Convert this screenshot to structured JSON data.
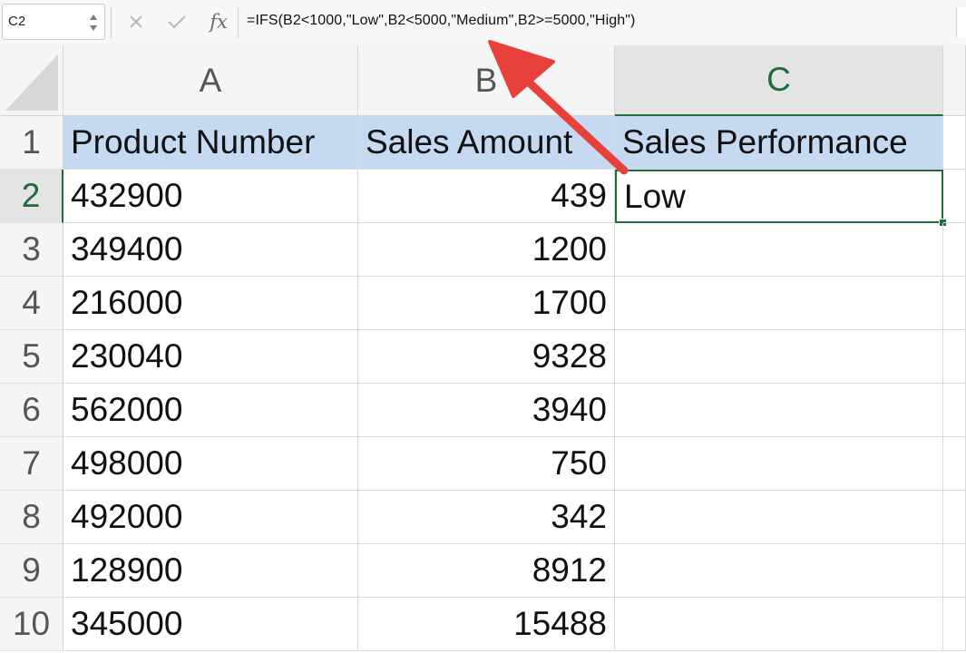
{
  "name_box": {
    "value": "C2"
  },
  "formula_bar": {
    "cancel_icon": "close-icon",
    "enter_icon": "checkmark-icon",
    "fx_label": "fx",
    "formula": "=IFS(B2<1000,\"Low\",B2<5000,\"Medium\",B2>=5000,\"High\")"
  },
  "columns": [
    "A",
    "B",
    "C"
  ],
  "rows": [
    "1",
    "2",
    "3",
    "4",
    "5",
    "6",
    "7",
    "8",
    "9",
    "10"
  ],
  "table": {
    "headers": [
      "Product Number",
      "Sales Amount",
      "Sales Performance"
    ],
    "data": [
      [
        "432900",
        "439",
        "Low"
      ],
      [
        "349400",
        "1200",
        ""
      ],
      [
        "216000",
        "1700",
        ""
      ],
      [
        "230040",
        "9328",
        ""
      ],
      [
        "562000",
        "3940",
        ""
      ],
      [
        "498000",
        "750",
        ""
      ],
      [
        "492000",
        "342",
        ""
      ],
      [
        "128900",
        "8912",
        ""
      ],
      [
        "345000",
        "15488",
        ""
      ]
    ]
  },
  "selection": {
    "cell": "C2",
    "column": "C",
    "row": "2"
  },
  "colors": {
    "header_fill": "#c5d9f1",
    "selection_green": "#1f6b3a",
    "arrow_red": "#e8413c"
  }
}
